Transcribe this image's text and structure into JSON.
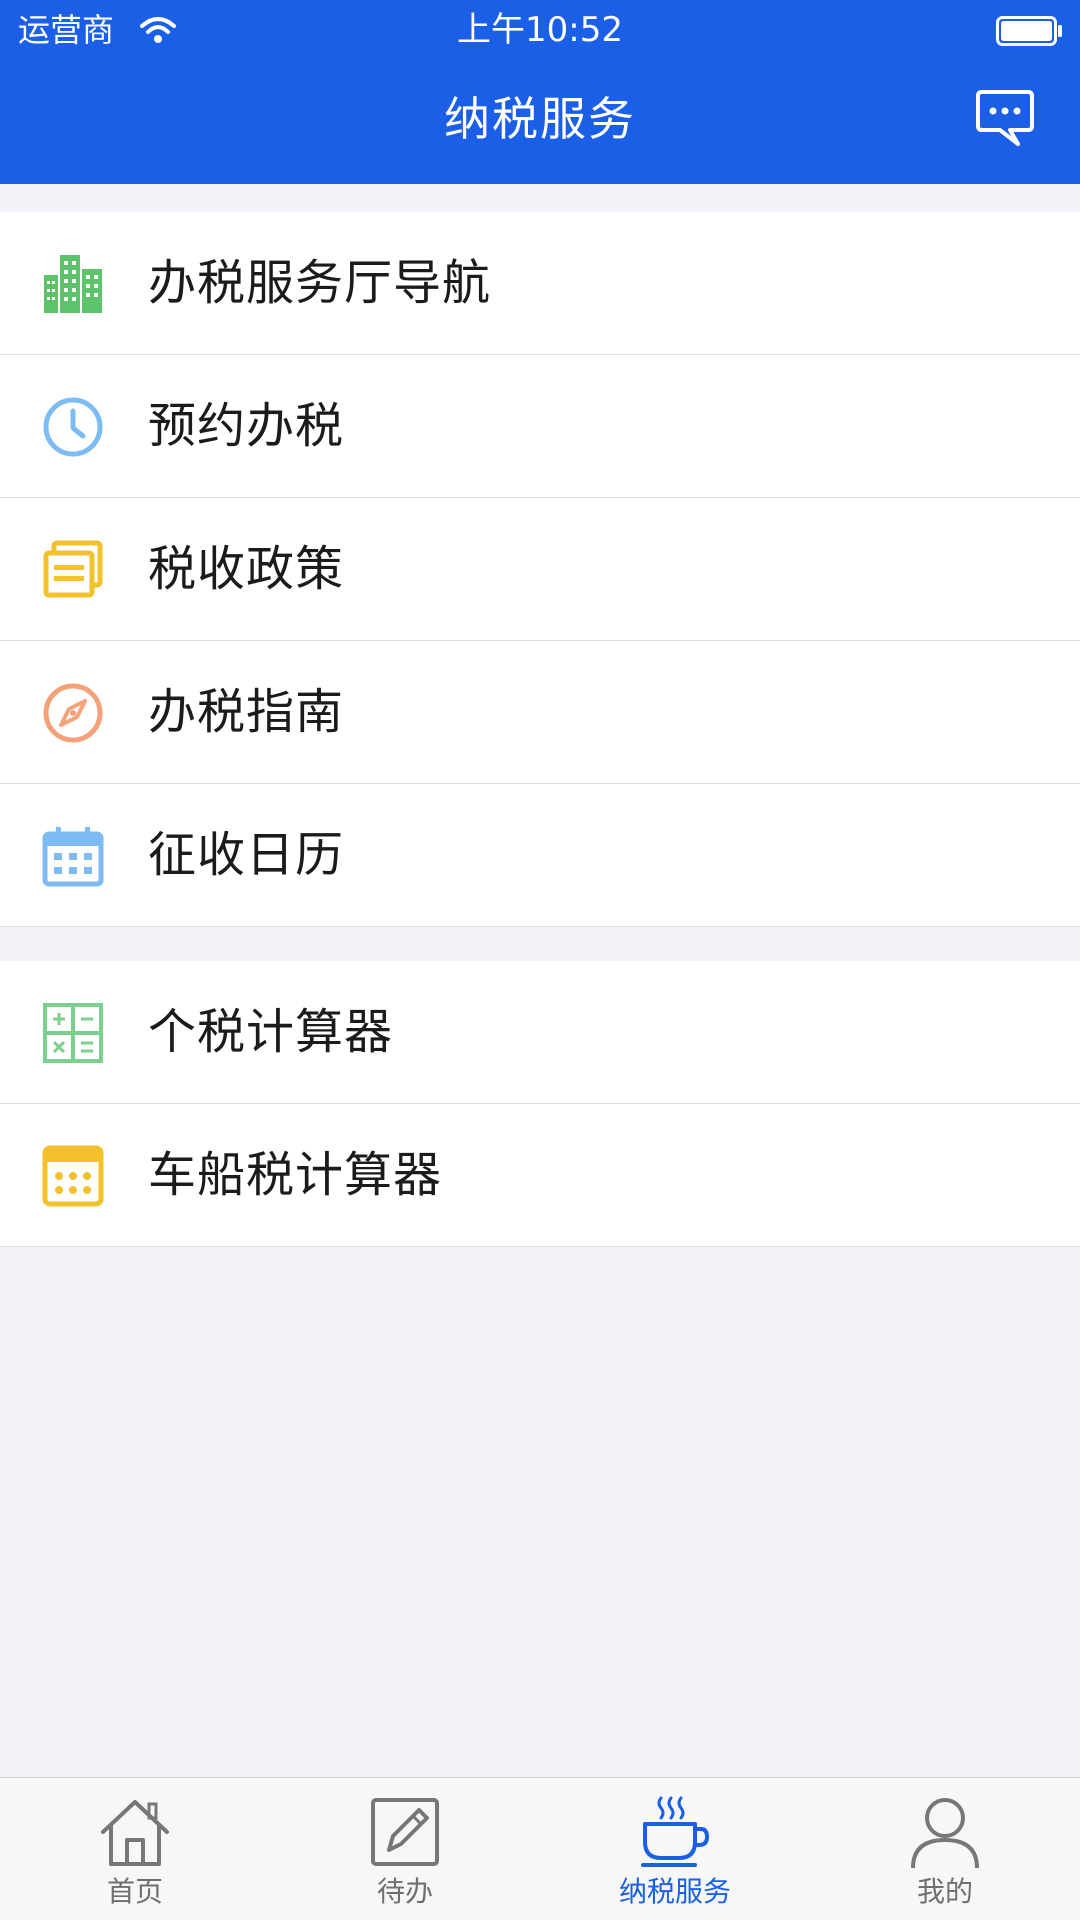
{
  "status_bar": {
    "carrier": "运营商",
    "time": "上午10:52"
  },
  "nav": {
    "title": "纳税服务",
    "right_icon": "message-icon"
  },
  "groups": [
    {
      "items": [
        {
          "label": "办税服务厅导航",
          "icon": "buildings-icon",
          "color": "#5dc46b"
        },
        {
          "label": "预约办税",
          "icon": "clock-icon",
          "color": "#7dbcf3"
        },
        {
          "label": "税收政策",
          "icon": "documents-icon",
          "color": "#f2c12c"
        },
        {
          "label": "办税指南",
          "icon": "compass-icon",
          "color": "#f3a27a"
        },
        {
          "label": "征收日历",
          "icon": "calendar-icon",
          "color": "#7dbcf3"
        }
      ]
    },
    {
      "items": [
        {
          "label": "个税计算器",
          "icon": "calculator-icon",
          "color": "#7ccf8c"
        },
        {
          "label": "车船税计算器",
          "icon": "keypad-icon",
          "color": "#f2c12c"
        }
      ]
    }
  ],
  "tab_bar": {
    "tabs": [
      {
        "label": "首页",
        "icon": "home-icon",
        "active": false
      },
      {
        "label": "待办",
        "icon": "edit-icon",
        "active": false
      },
      {
        "label": "纳税服务",
        "icon": "coffee-cup-icon",
        "active": true
      },
      {
        "label": "我的",
        "icon": "user-icon",
        "active": false
      }
    ]
  },
  "colors": {
    "primary": "#1a5fe6",
    "background": "#f1f3f8",
    "tab_inactive": "#6f6f6f"
  }
}
